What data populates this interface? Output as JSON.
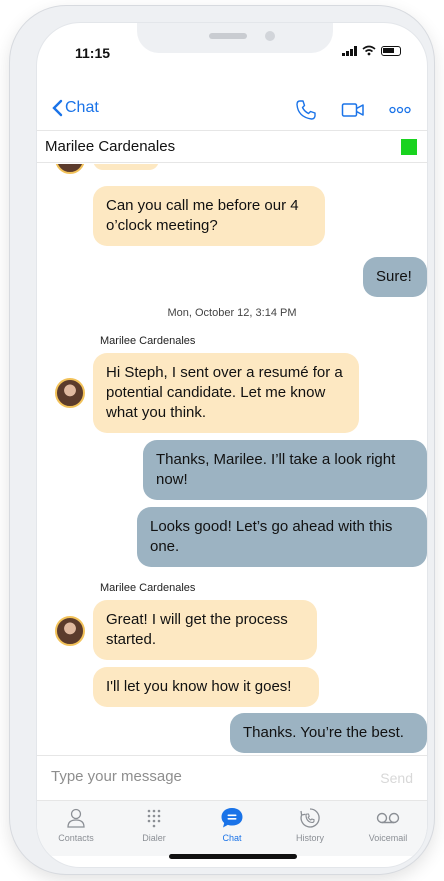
{
  "status": {
    "time": "11:15"
  },
  "nav": {
    "back_label": "Chat"
  },
  "contact": {
    "name": "Marilee Cardenales",
    "presence_color": "#19d31f"
  },
  "messages": [
    {
      "direction": "in",
      "text": "Can you call me before our 4 o’clock meeting?"
    },
    {
      "direction": "out",
      "text": "Sure!"
    },
    {
      "type": "date",
      "text": "Mon, October 12, 3:14 PM"
    },
    {
      "type": "sender",
      "text": "Marilee Cardenales"
    },
    {
      "direction": "in",
      "text": "Hi Steph, I sent over a resumé for a potential candidate. Let me know what you think."
    },
    {
      "direction": "out",
      "text": "Thanks, Marilee. I’ll take a look right now!"
    },
    {
      "direction": "out",
      "text": "Looks good! Let’s go ahead with this one."
    },
    {
      "type": "sender",
      "text": "Marilee Cardenales"
    },
    {
      "direction": "in",
      "text": "Great! I will get the process started."
    },
    {
      "direction": "in",
      "text": "I'll let you know how it goes!"
    },
    {
      "direction": "out",
      "text": "Thanks. You’re the best."
    }
  ],
  "composer": {
    "placeholder": "Type your message",
    "send_label": "Send"
  },
  "tabs": [
    {
      "label": "Contacts",
      "icon": "contacts-icon"
    },
    {
      "label": "Dialer",
      "icon": "dialer-icon"
    },
    {
      "label": "Chat",
      "icon": "chat-icon",
      "active": true
    },
    {
      "label": "History",
      "icon": "history-icon"
    },
    {
      "label": "Voicemail",
      "icon": "voicemail-icon"
    }
  ],
  "colors": {
    "accent": "#1a73e8",
    "incoming_bubble": "#fde8c2",
    "outgoing_bubble": "#9cb3c2"
  }
}
